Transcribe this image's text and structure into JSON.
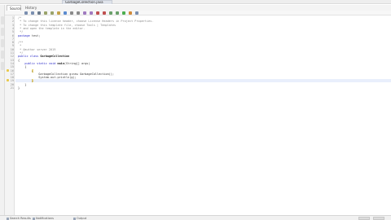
{
  "window": {
    "file_tab": "GarbageCollection.java"
  },
  "editor_tabs": [
    {
      "label": "Source",
      "active": true
    },
    {
      "label": "History",
      "active": false
    }
  ],
  "toolbar": {
    "icons": [
      "back-icon",
      "forward-icon",
      "search-icon",
      "prev-occurrence-icon",
      "next-occurrence-icon",
      "toggle-highlight-icon",
      "toggle-bookmark-icon",
      "prev-bookmark-icon",
      "next-bookmark-icon",
      "shift-left-icon",
      "shift-right-icon",
      "record-macro-icon",
      "stop-macro-icon",
      "comment-icon",
      "uncomment-icon",
      "run-icon",
      "debug-icon",
      "test-icon"
    ]
  },
  "code": {
    "lines": [
      {
        "num": "1",
        "tokens": [
          {
            "t": "/*",
            "k": "comment"
          }
        ]
      },
      {
        "num": "2",
        "tokens": [
          {
            "t": " * To change this license header, choose License Headers in Project Properties.",
            "k": "comment"
          }
        ]
      },
      {
        "num": "3",
        "tokens": [
          {
            "t": " * To change this template file, choose Tools | Templates",
            "k": "comment"
          }
        ]
      },
      {
        "num": "4",
        "tokens": [
          {
            "t": " * and open the template in the editor.",
            "k": "comment"
          }
        ]
      },
      {
        "num": "5",
        "tokens": [
          {
            "t": " */",
            "k": "comment"
          }
        ]
      },
      {
        "num": "6",
        "tokens": [
          {
            "t": "package ",
            "k": "kw"
          },
          {
            "t": "test;",
            "k": "ident"
          }
        ]
      },
      {
        "num": "7",
        "tokens": []
      },
      {
        "num": "8",
        "tokens": [
          {
            "t": "/**",
            "k": "comment"
          }
        ]
      },
      {
        "num": "9",
        "tokens": [
          {
            "t": " *",
            "k": "comment"
          }
        ]
      },
      {
        "num": "10",
        "tokens": [
          {
            "t": " * @author ",
            "k": "comment"
          },
          {
            "t": "server 2019",
            "k": "comment"
          }
        ]
      },
      {
        "num": "11",
        "tokens": [
          {
            "t": " */",
            "k": "comment"
          }
        ]
      },
      {
        "num": "12",
        "tokens": [
          {
            "t": "public class ",
            "k": "kw"
          },
          {
            "t": "GarbageCollection",
            "k": "cls"
          }
        ]
      },
      {
        "num": "13",
        "tokens": [
          {
            "t": "{",
            "k": "ident"
          }
        ]
      },
      {
        "num": "14",
        "tokens": [
          {
            "t": "    public static void ",
            "k": "kw"
          },
          {
            "t": "main",
            "k": "cls"
          },
          {
            "t": "(String[] args)",
            "k": "ident"
          }
        ]
      },
      {
        "num": "15",
        "tokens": [
          {
            "t": "    {",
            "k": "ident"
          }
        ]
      },
      {
        "num": "16",
        "tokens": [
          {
            "t": "        ",
            "k": "ident"
          },
          {
            "t": "{",
            "k": "bracket"
          }
        ]
      },
      {
        "num": "17",
        "tokens": [
          {
            "t": "            GarbageCollection g=new GarbageCollection();",
            "k": "ident"
          }
        ]
      },
      {
        "num": "18",
        "tokens": [
          {
            "t": "            System.out.println(g);",
            "k": "ident"
          }
        ]
      },
      {
        "num": "19",
        "tokens": [
          {
            "t": "        ",
            "k": "ident"
          },
          {
            "t": "}",
            "k": "bracket"
          }
        ]
      },
      {
        "num": "20",
        "tokens": [
          {
            "t": "    }",
            "k": "ident"
          }
        ]
      },
      {
        "num": "21",
        "tokens": [
          {
            "t": "}",
            "k": "ident"
          }
        ]
      }
    ],
    "current_line": 19
  },
  "statusbar": {
    "items": [
      "Search Results",
      "Notifications",
      "Output"
    ]
  },
  "colors": {
    "keyword": "#2a2ac8",
    "comment": "#8a8a8a",
    "current_line": "#e9effc",
    "bracket_highlight": "#ffe88a"
  }
}
